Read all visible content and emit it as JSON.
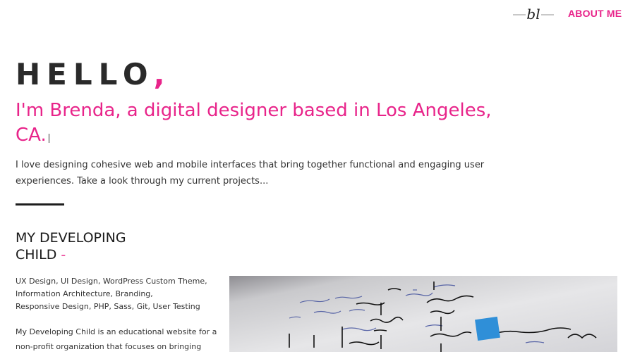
{
  "nav": {
    "logo_text": "bl",
    "about_label": "ABOUT ME"
  },
  "hero": {
    "hello": "HELLO",
    "hello_punct": ",",
    "intro": "I'm Brenda, a digital designer based in Los Angeles, CA.",
    "description": "I love designing cohesive web and mobile interfaces that bring together functional and engaging user experiences. Take a look through my current projects..."
  },
  "project": {
    "title": "MY DEVELOPING CHILD",
    "title_dash": "-",
    "tags": [
      "UX Design, UI Design, WordPress Custom Theme,",
      "Information Architecture, Branding,",
      "Responsive Design, PHP, Sass, Git, User Testing"
    ],
    "summary": "My Developing Child is an educational website for a non-profit organization that focuses on bringing"
  },
  "colors": {
    "accent": "#e8248a",
    "text": "#222222",
    "sticky_note": "#2f8fd8"
  },
  "icons": {
    "logo": "bl-script-logo"
  }
}
